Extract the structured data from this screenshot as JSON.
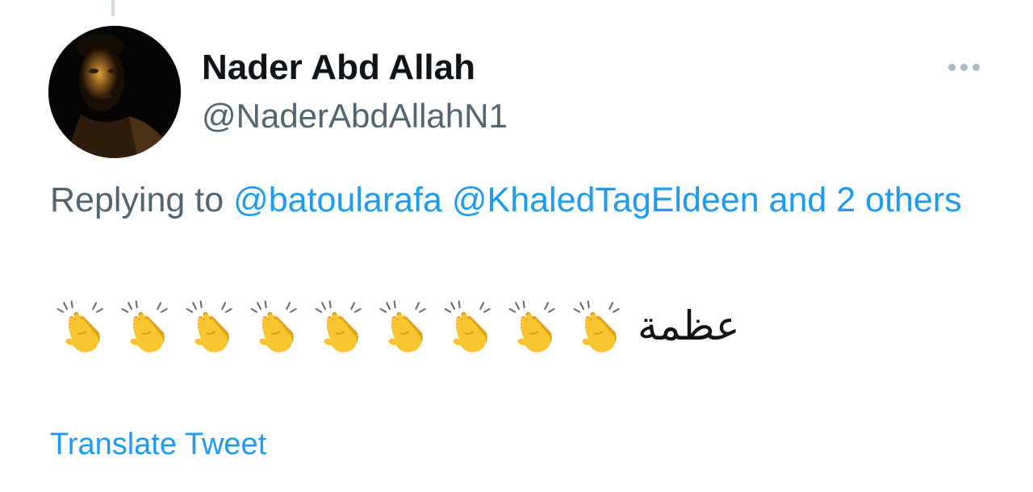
{
  "tweet": {
    "author": {
      "display_name": "Nader Abd Allah",
      "handle": "@NaderAbdAllahN1",
      "avatar_icon": "profile-photo-avatar"
    },
    "more_icon": "ellipsis-horizontal-icon",
    "reply_context": {
      "prefix": "Replying to",
      "mentions": [
        "@batoularafa",
        "@KhaledTagEldeen"
      ],
      "suffix": "and 2 others"
    },
    "body": {
      "emoji": "clapping-hands-emoji",
      "emoji_count": 9,
      "text": "عظمة"
    },
    "translate_label": "Translate Tweet"
  },
  "colors": {
    "link": "#1d9bf0",
    "secondary_text": "#536471",
    "primary_text": "#0f1419",
    "more_dots": "#aab8c2",
    "thread_line": "#cfd9de"
  }
}
